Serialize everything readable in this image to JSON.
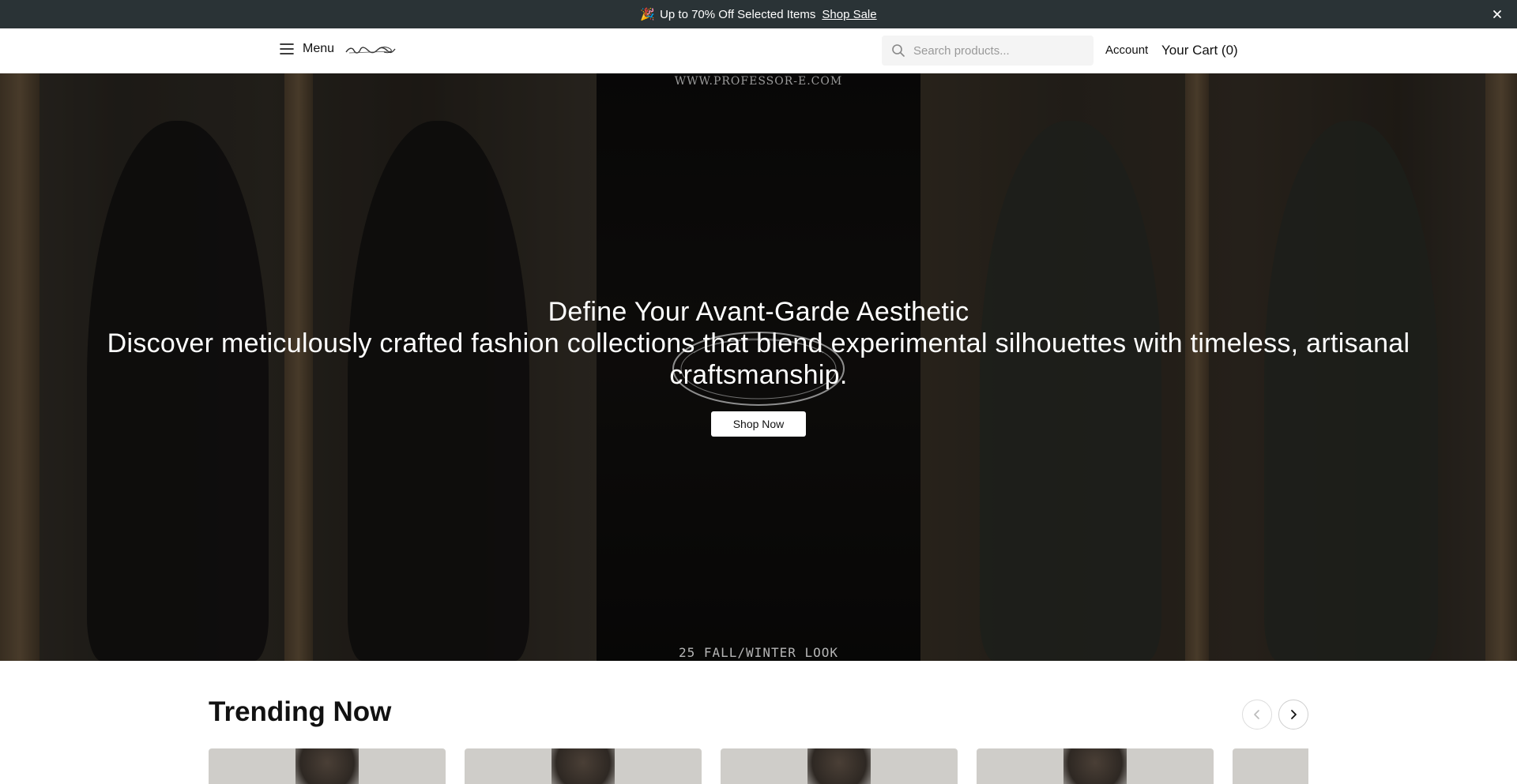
{
  "announcement": {
    "emoji": "🎉",
    "text": "Up to 70% Off Selected Items",
    "link_label": "Shop Sale",
    "close_icon": "close-icon"
  },
  "header": {
    "menu_label": "Menu",
    "menu_icon": "hamburger-icon",
    "logo_icon": "brand-logo",
    "search_placeholder": "Search products...",
    "search_icon": "search-icon",
    "account_label": "Account",
    "cart_label": "Your Cart (0)"
  },
  "hero": {
    "top_text": "WWW.PROFESSOR-E.COM",
    "bottom_text": "25 FALL/WINTER LOOK",
    "title": "Define Your Avant-Garde Aesthetic",
    "subtitle": "Discover meticulously crafted fashion collections that blend experimental silhouettes with timeless, artisanal craftsmanship.",
    "cta_label": "Shop Now"
  },
  "trending": {
    "title": "Trending Now",
    "prev_icon": "chevron-left-icon",
    "next_icon": "chevron-right-icon",
    "card_count": 5
  },
  "colors": {
    "announcement_bg": "#2a3336",
    "hero_text": "#ffffff",
    "button_bg": "#ffffff"
  }
}
